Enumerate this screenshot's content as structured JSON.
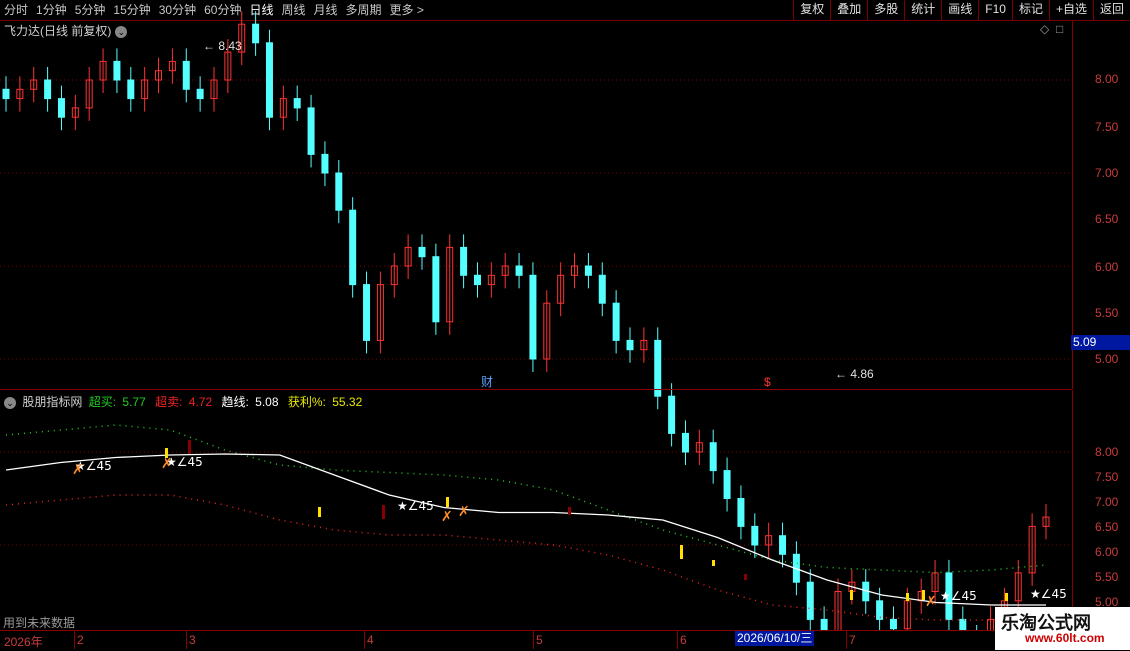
{
  "toolbar": {
    "periods": [
      "分时",
      "1分钟",
      "5分钟",
      "15分钟",
      "30分钟",
      "60分钟",
      "日线",
      "周线",
      "月线",
      "多周期",
      "更多 >"
    ],
    "active_period": "日线",
    "tools": [
      "复权",
      "叠加",
      "多股",
      "统计",
      "画线",
      "F10",
      "标记",
      "+自选",
      "返回"
    ]
  },
  "stock": {
    "title": "飞力达(日线 前复权)",
    "high_label": "8.43",
    "low_label": "4.86",
    "current_price": "5.09",
    "marker_cai": "财",
    "marker_dollar": "$"
  },
  "price_axis": {
    "ticks": [
      "8.00",
      "7.50",
      "7.00",
      "6.50",
      "6.00",
      "5.50",
      "5.00"
    ]
  },
  "indicator": {
    "name": "股朋指标网",
    "items": [
      {
        "label": "超买:",
        "value": "5.77",
        "color": "#22cc22"
      },
      {
        "label": "超卖:",
        "value": "4.72",
        "color": "#ee2222"
      },
      {
        "label": "趋线:",
        "value": "5.08",
        "color": "#ffffff"
      },
      {
        "label": "获利%:",
        "value": "55.32",
        "color": "#e8e800"
      }
    ],
    "ticks": [
      "8.00",
      "7.50",
      "7.00",
      "6.50",
      "6.00",
      "5.50",
      "5.00"
    ],
    "star_label": "∠45",
    "future_note": "用到未来数据"
  },
  "date_axis": {
    "labels": [
      "2026年",
      "2",
      "3",
      "4",
      "5",
      "6",
      "2026/06/10/三",
      "7"
    ]
  },
  "watermark": {
    "name": "乐淘公式网",
    "url": "www.60lt.com"
  },
  "colors": {
    "up": "#ff3232",
    "down": "#54ffff",
    "axis": "#c83c3c",
    "grid": "#8a0000"
  },
  "chart_data": {
    "type": "candlestick",
    "series": [
      {
        "name": "K线",
        "close_approx": [
          7.9,
          7.95,
          8.0,
          7.9,
          7.8,
          7.85,
          8.0,
          8.1,
          8.0,
          7.9,
          8.0,
          8.05,
          8.1,
          7.95,
          7.9,
          8.0,
          8.15,
          8.3,
          8.2,
          7.8,
          7.9,
          7.85,
          7.6,
          7.5,
          7.3,
          6.9,
          6.6,
          6.9,
          7.0,
          7.1,
          7.05,
          6.7,
          7.1,
          6.95,
          6.9,
          6.95,
          7.0,
          6.95,
          6.5,
          6.8,
          6.95,
          7.0,
          6.95,
          6.8,
          6.6,
          6.55,
          6.6,
          6.3,
          6.1,
          6.0,
          6.05,
          5.9,
          5.75,
          5.6,
          5.5,
          5.55,
          5.45,
          5.3,
          5.1,
          5.0,
          5.25,
          5.3,
          5.2,
          5.1,
          5.05,
          5.2,
          5.25,
          5.35,
          5.1,
          5.0,
          4.95,
          5.1,
          5.2,
          5.35,
          5.6,
          5.65
        ]
      },
      {
        "name": "趋线",
        "values": [
          7.7,
          7.85,
          7.95,
          8.0,
          8.02,
          8.0,
          7.6,
          7.2,
          6.95,
          6.85,
          6.85,
          6.8,
          6.7,
          6.35,
          5.9,
          5.5,
          5.2,
          5.05,
          5.0,
          5.0
        ]
      },
      {
        "name": "超买",
        "values": [
          8.4,
          8.5,
          8.6,
          8.5,
          8.1,
          7.8,
          7.7,
          7.65,
          7.6,
          7.5,
          7.3,
          6.9,
          6.5,
          6.2,
          5.9,
          5.75,
          5.7,
          5.65,
          5.7,
          5.8
        ]
      },
      {
        "name": "超卖",
        "values": [
          7.0,
          7.1,
          7.2,
          7.2,
          7.0,
          6.7,
          6.5,
          6.4,
          6.4,
          6.3,
          6.2,
          6.0,
          5.7,
          5.3,
          5.0,
          4.9,
          4.75,
          4.7,
          4.7,
          4.72
        ]
      }
    ],
    "y_range": [
      4.8,
      8.6
    ],
    "x_labels": [
      "2026年",
      "2",
      "3",
      "4",
      "5",
      "6",
      "7"
    ]
  }
}
